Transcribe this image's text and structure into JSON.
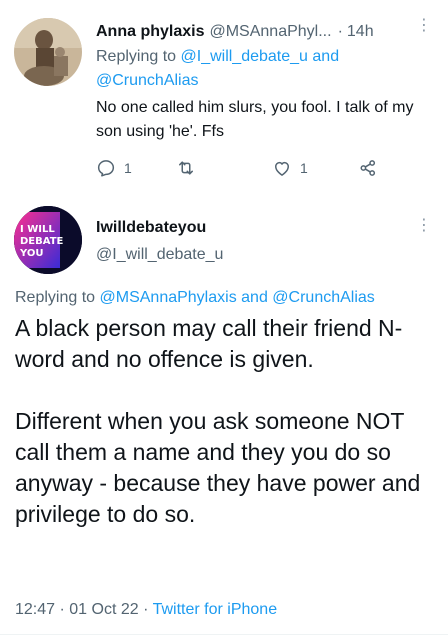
{
  "reply": {
    "name": "Anna phylaxis",
    "handle": "@MSAnnaPhyl...",
    "time_sep": "·",
    "time": "14h",
    "replying_prefix": "Replying to",
    "mention_1": "@I_will_debate_u",
    "and": "and",
    "mention_2": "@CrunchAlias",
    "text": "No one called him slurs, you fool. I talk of my son using 'he'. Ffs",
    "reply_count": "1",
    "retweet_count": "",
    "like_count": "1",
    "icons": [
      "reply-icon",
      "retweet-icon",
      "like-icon",
      "share-icon",
      "more-icon"
    ]
  },
  "main": {
    "name": "Iwilldebateyou",
    "handle": "@I_will_debate_u",
    "avatar_text": [
      "I WILL",
      "DEBATE",
      "YOU"
    ],
    "replying_prefix": "Replying to",
    "mention_1": "@MSAnnaPhylaxis",
    "and": "and",
    "mention_2": "@CrunchAlias",
    "text": "A black person may call their friend N-word and no offence is given.\n\nDifferent when you ask someone NOT call them a name and they you do so anyway - because they have power and privilege to do so.",
    "time": "12:47",
    "sep1": "·",
    "date": "01 Oct 22",
    "sep2": "·",
    "source": "Twitter for iPhone"
  },
  "colors": {
    "text": "#0f1419",
    "secondary": "#536471",
    "accent": "#1d9bf0"
  }
}
